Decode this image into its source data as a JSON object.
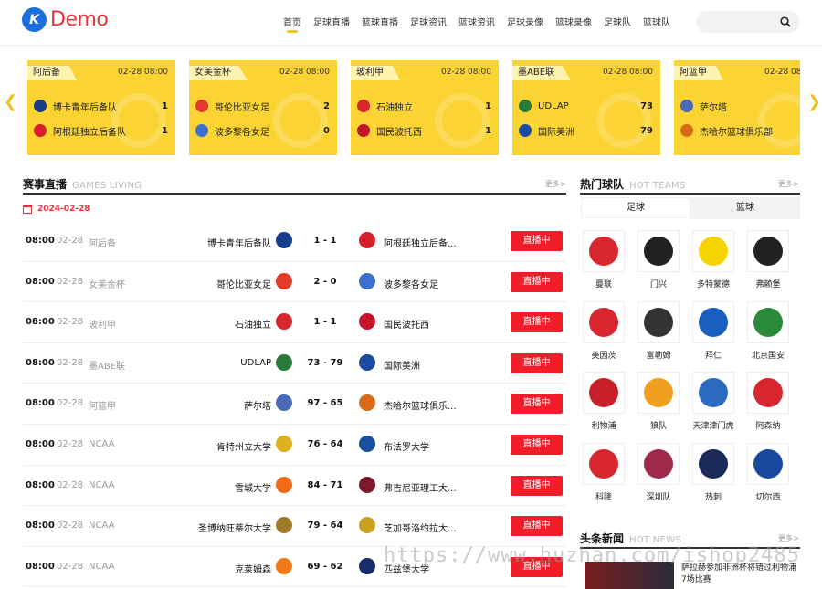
{
  "header": {
    "logo_mark": "K",
    "logo_text": "Demo",
    "nav": [
      "首页",
      "足球直播",
      "篮球直播",
      "足球资讯",
      "篮球资讯",
      "足球录像",
      "篮球录像",
      "足球队",
      "篮球队"
    ],
    "search_placeholder": ""
  },
  "carousel": [
    {
      "league": "阿后备",
      "time": "02-28 08:00",
      "home": "博卡青年后备队",
      "home_score": "1",
      "away": "阿根廷独立后备队",
      "away_score": "1",
      "home_color": "#1a3c8c",
      "away_color": "#d81e2a"
    },
    {
      "league": "女美金杯",
      "time": "02-28 08:00",
      "home": "哥伦比亚女足",
      "home_score": "2",
      "away": "波多黎各女足",
      "away_score": "0",
      "home_color": "#e23b2a",
      "away_color": "#3d6fcf"
    },
    {
      "league": "玻利甲",
      "time": "02-28 08:00",
      "home": "石油独立",
      "home_score": "1",
      "away": "国民波托西",
      "away_score": "1",
      "home_color": "#d8262e",
      "away_color": "#c4162a"
    },
    {
      "league": "墨ABE联",
      "time": "02-28 08:00",
      "home": "UDLAP",
      "home_score": "73",
      "away": "国际美洲",
      "away_score": "79",
      "home_color": "#2a7a3a",
      "away_color": "#1b4aa0"
    },
    {
      "league": "阿篮甲",
      "time": "02-28 08:00",
      "home": "萨尔塔",
      "home_score": "",
      "away": "杰哈尔篮球俱乐部",
      "away_score": "",
      "home_color": "#4a6ab8",
      "away_color": "#d86a1a"
    }
  ],
  "live": {
    "title": "赛事直播",
    "subtitle": "GAMES LIVING",
    "more": "更多>",
    "date": "2024-02-28",
    "matches": [
      {
        "time": "08:00",
        "date": "02-28",
        "league": "阿后备",
        "home": "博卡青年后备队",
        "score": "1 - 1",
        "away": "阿根廷独立后备...",
        "btn": "直播中",
        "hc": "#1a3c8c",
        "ac": "#d81e2a"
      },
      {
        "time": "08:00",
        "date": "02-28",
        "league": "女美金杯",
        "home": "哥伦比亚女足",
        "score": "2 - 0",
        "away": "波多黎各女足",
        "btn": "直播中",
        "hc": "#e23b2a",
        "ac": "#3d6fcf"
      },
      {
        "time": "08:00",
        "date": "02-28",
        "league": "玻利甲",
        "home": "石油独立",
        "score": "1 - 1",
        "away": "国民波托西",
        "btn": "直播中",
        "hc": "#d8262e",
        "ac": "#c4162a"
      },
      {
        "time": "08:00",
        "date": "02-28",
        "league": "墨ABE联",
        "home": "UDLAP",
        "score": "73 - 79",
        "away": "国际美洲",
        "btn": "直播中",
        "hc": "#2a7a3a",
        "ac": "#1b4aa0"
      },
      {
        "time": "08:00",
        "date": "02-28",
        "league": "阿篮甲",
        "home": "萨尔塔",
        "score": "97 - 65",
        "away": "杰哈尔篮球俱乐...",
        "btn": "直播中",
        "hc": "#4a6ab8",
        "ac": "#d86a1a"
      },
      {
        "time": "08:00",
        "date": "02-28",
        "league": "NCAA",
        "home": "肯特州立大学",
        "score": "76 - 64",
        "away": "布法罗大学",
        "btn": "直播中",
        "hc": "#e0b020",
        "ac": "#1a4fa0"
      },
      {
        "time": "08:00",
        "date": "02-28",
        "league": "NCAA",
        "home": "雪城大学",
        "score": "84 - 71",
        "away": "弗吉尼亚理工大...",
        "btn": "直播中",
        "hc": "#f06a1a",
        "ac": "#7a1a2a"
      },
      {
        "time": "08:00",
        "date": "02-28",
        "league": "NCAA",
        "home": "圣博纳旺蒂尔大学",
        "score": "79 - 64",
        "away": "芝加哥洛约拉大...",
        "btn": "直播中",
        "hc": "#a07a2a",
        "ac": "#caa020"
      },
      {
        "time": "08:00",
        "date": "02-28",
        "league": "NCAA",
        "home": "克莱姆森",
        "score": "69 - 62",
        "away": "匹兹堡大学",
        "btn": "直播中",
        "hc": "#f07a1a",
        "ac": "#1a2a6a"
      }
    ]
  },
  "hot_teams": {
    "title": "热门球队",
    "subtitle": "HOT TEAMS",
    "more": "更多>",
    "tabs": [
      "足球",
      "篮球"
    ],
    "teams": [
      {
        "name": "曼联",
        "color": "#d8262e"
      },
      {
        "name": "门兴",
        "color": "#222222"
      },
      {
        "name": "多特蒙德",
        "color": "#f5d400"
      },
      {
        "name": "弗赖堡",
        "color": "#222222"
      },
      {
        "name": "美因茨",
        "color": "#d8262e"
      },
      {
        "name": "富勒姆",
        "color": "#333333"
      },
      {
        "name": "拜仁",
        "color": "#1a5fbf"
      },
      {
        "name": "北京国安",
        "color": "#2a8a3a"
      },
      {
        "name": "利物浦",
        "color": "#c8202a"
      },
      {
        "name": "狼队",
        "color": "#f0a020"
      },
      {
        "name": "天津津门虎",
        "color": "#2a6ac0"
      },
      {
        "name": "阿森纳",
        "color": "#d8262e"
      },
      {
        "name": "科隆",
        "color": "#d8262e"
      },
      {
        "name": "深圳队",
        "color": "#a02a4a"
      },
      {
        "name": "热刺",
        "color": "#1a2a5a"
      },
      {
        "name": "切尔西",
        "color": "#1a4aa0"
      }
    ]
  },
  "news": {
    "title": "头条新闻",
    "subtitle": "HOT NEWS",
    "more": "更多>",
    "headline": "萨拉赫参加非洲杯将错过利物浦7场比赛"
  },
  "watermark": "https://www.huzhan.com/ishop2485"
}
